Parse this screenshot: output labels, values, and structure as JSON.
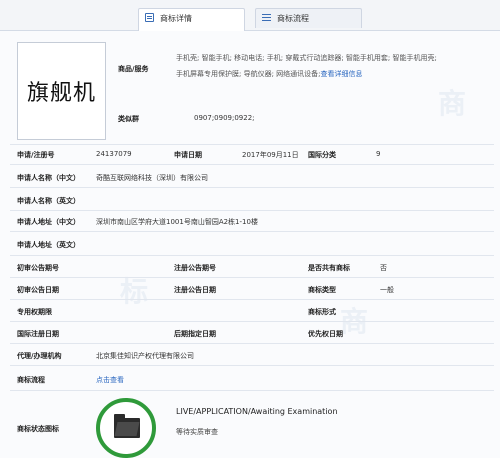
{
  "tabs": [
    {
      "label": "商标详情",
      "icon": "card-icon"
    },
    {
      "label": "商标流程",
      "icon": "list-icon"
    }
  ],
  "mark": {
    "text": "旗舰机"
  },
  "goods": {
    "label": "商品/服务",
    "line1": "手机壳; 智能手机; 移动电话; 手机; 穿戴式行动追踪器; 智能手机用套; 智能手机用壳;",
    "line2": "手机屏幕专用保护膜; 导航仪器; 网络通讯设备;",
    "more": "查看详细信息"
  },
  "similar_group": {
    "label": "类似群",
    "value": "0907;0909;0922;"
  },
  "fields": {
    "reg_no_label": "申请/注册号",
    "reg_no": "24137079",
    "app_date_label": "申请日期",
    "app_date": "2017年09月11日",
    "intl_class_label": "国际分类",
    "intl_class": "9",
    "applicant_cn_label": "申请人名称（中文）",
    "applicant_cn": "奇酷互联网络科技（深圳）有限公司",
    "applicant_en_label": "申请人名称（英文）",
    "address_cn_label": "申请人地址（中文）",
    "address_cn": "深圳市南山区学府大道1001号南山智园A2栋1-10楼",
    "address_en_label": "申请人地址（英文）",
    "prelim_no_label": "初审公告期号",
    "reg_pub_no_label": "注册公告期号",
    "shared_label": "是否共有商标",
    "shared": "否",
    "prelim_date_label": "初审公告日期",
    "reg_pub_date_label": "注册公告日期",
    "mark_type_label": "商标类型",
    "mark_type": "一般",
    "exclusive_label": "专用权期限",
    "mark_form_label": "商标形式",
    "intl_reg_date_label": "国际注册日期",
    "later_date_label": "后期指定日期",
    "priority_label": "优先权日期",
    "agent_label": "代理/办理机构",
    "agent": "北京集佳知识产权代理有限公司",
    "flow_label": "商标流程",
    "flow_link": "点击查看",
    "status_label": "商标状态图标",
    "status_text": "LIVE/APPLICATION/Awaiting Examination",
    "status_sub": "等待实质审查"
  }
}
